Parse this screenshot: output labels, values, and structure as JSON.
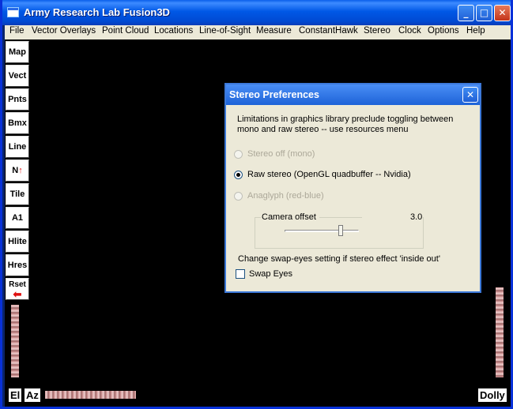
{
  "window": {
    "title": "Army Research Lab Fusion3D",
    "controls": {
      "minimize": "_",
      "maximize": "□",
      "close": "✕"
    }
  },
  "menubar": {
    "items": [
      "File",
      "Vector Overlays",
      "Point Cloud",
      "Locations",
      "Line-of-Sight",
      "Measure",
      "ConstantHawk",
      "Stereo",
      "Clock",
      "Options",
      "Help"
    ]
  },
  "toolbar": {
    "buttons": [
      "Map",
      "Vect",
      "Pnts",
      "Bmx",
      "Line",
      "N",
      "Tile",
      "A1",
      "Hlite",
      "Hres",
      "Rset"
    ],
    "north_arrow": "↑",
    "reset_arrow": "⬅"
  },
  "corner_buttons": {
    "el": "El",
    "az": "Az",
    "dolly": "Dolly"
  },
  "dialog": {
    "title": "Stereo Preferences",
    "close": "✕",
    "message": "Limitations in graphics library preclude toggling between mono and raw stereo -- use resources menu",
    "options": [
      {
        "label": "Stereo off (mono)",
        "checked": false,
        "enabled": false
      },
      {
        "label": "Raw stereo (OpenGL quadbuffer -- Nvidia)",
        "checked": true,
        "enabled": true
      },
      {
        "label": "Anaglyph (red-blue)",
        "checked": false,
        "enabled": false
      }
    ],
    "camera_offset": {
      "label": "Camera offset",
      "value": "3.0",
      "slider_fraction": 0.73
    },
    "swap_hint": "Change swap-eyes setting if stereo effect 'inside out'",
    "swap_eyes": {
      "label": "Swap Eyes",
      "checked": false
    }
  }
}
